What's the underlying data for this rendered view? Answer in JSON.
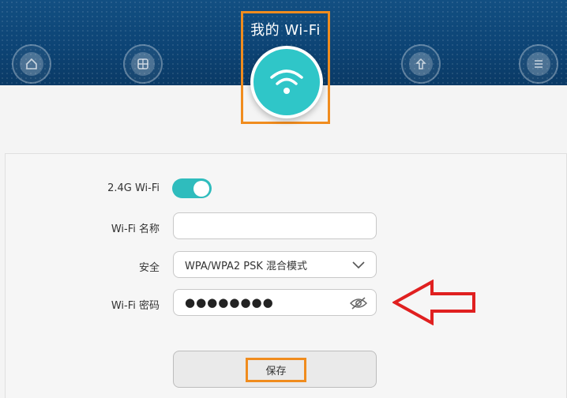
{
  "header": {
    "active_tab_title": "我的 Wi-Fi",
    "nav_items": [
      {
        "label": "",
        "icon": "home-icon"
      },
      {
        "label": "",
        "icon": "devices-icon"
      },
      {
        "label": "",
        "icon": "dual-band-icon"
      },
      {
        "label": "",
        "icon": "menu-icon"
      }
    ]
  },
  "form": {
    "wifi24_label": "2.4G Wi-Fi",
    "wifi24_enabled": true,
    "ssid_label": "Wi-Fi 名称",
    "ssid_value": "",
    "security_label": "安全",
    "security_value": "WPA/WPA2 PSK 混合模式",
    "password_label": "Wi-Fi 密码",
    "password_value": "●●●●●●●●",
    "save_label": "保存"
  },
  "colors": {
    "accent": "#2fc6c8",
    "header_bg": "#0d4475",
    "highlight": "#f08c1e",
    "arrow": "#e02020"
  }
}
